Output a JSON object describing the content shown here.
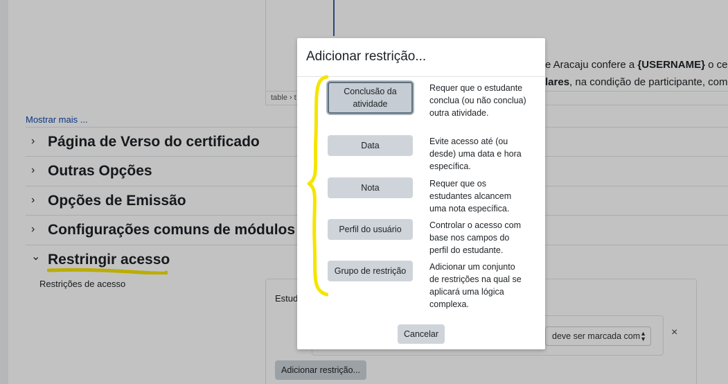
{
  "editor": {
    "path_label": "table › t",
    "line1_prefix": "e Aracaju confere a ",
    "line1_bold": "{USERNAME}",
    "line1_suffix": " o ce",
    "line2_bold": "lares",
    "line2_suffix": ", na condição de participante, com"
  },
  "show_more": "Mostrar mais ...",
  "sections": [
    {
      "title": "Página de Verso do certificado",
      "chevron": "›"
    },
    {
      "title": "Outras Opções",
      "chevron": "›"
    },
    {
      "title": "Opções de Emissão",
      "chevron": "›"
    },
    {
      "title": "Configurações comuns de módulos",
      "chevron": "›"
    },
    {
      "title": "Restringir acesso",
      "chevron": "⌄"
    }
  ],
  "restrict": {
    "label": "Restrições de acesso",
    "student_text": "Estud",
    "select_value": "deve ser marcada com",
    "add_button": "Adicionar restrição...",
    "close_symbol": "×"
  },
  "modal": {
    "title": "Adicionar restrição...",
    "options": [
      {
        "button": "Conclusão da atividade",
        "description": "Requer que o estudante conclua (ou não conclua) outra atividade."
      },
      {
        "button": "Data",
        "description": "Evite acesso até (ou desde) uma data e hora específica."
      },
      {
        "button": "Nota",
        "description": "Requer que os estudantes alcancem uma nota específica."
      },
      {
        "button": "Perfil do usuário",
        "description": "Controlar o acesso com base nos campos do perfil do estudante."
      },
      {
        "button": "Grupo de restrição",
        "description": "Adicionar um conjunto de restrições na qual se aplicará uma lógica complexa."
      }
    ],
    "cancel": "Cancelar"
  },
  "colors": {
    "annotation_yellow": "#f5e400",
    "link_blue": "#0f47ad",
    "button_gray": "#ced4da"
  }
}
